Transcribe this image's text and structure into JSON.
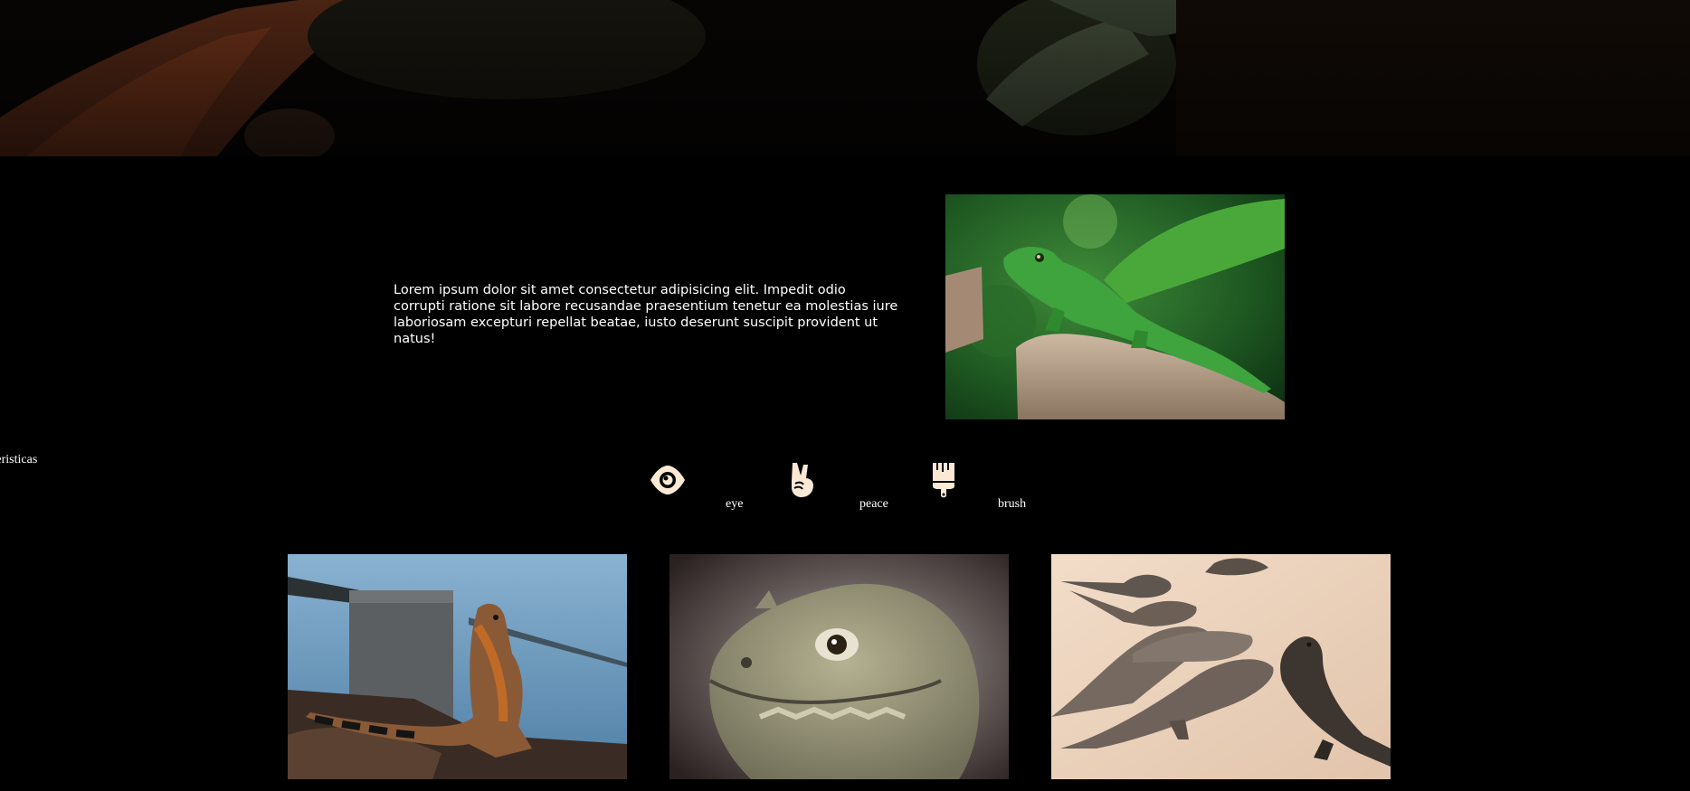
{
  "hero": {
    "image": "lizard-closeup-dark-photo"
  },
  "intro": {
    "text": "Lorem ipsum dolor sit amet consectetur adipisicing elit. Impedit odio corrupti ratione sit labore recusandae praesentium tenetur ea molestias iure laboriosam excepturi repellat beatae, iusto deserunt suscipit provident ut natus!",
    "image": "green-lizard-on-stump-photo"
  },
  "characteristics": {
    "label": "acteristicas",
    "features": [
      {
        "icon": "eye-icon",
        "label": "eye"
      },
      {
        "icon": "peace-icon",
        "label": "peace"
      },
      {
        "icon": "brush-icon",
        "label": "brush"
      }
    ]
  },
  "gallery": [
    {
      "image": "iguana-by-water-photo"
    },
    {
      "image": "iguana-head-closeup-photo"
    },
    {
      "image": "iguanas-on-sand-photo"
    }
  ],
  "colors": {
    "background": "#000000",
    "icon": "#fbe9d4",
    "text": "#ffffff"
  }
}
